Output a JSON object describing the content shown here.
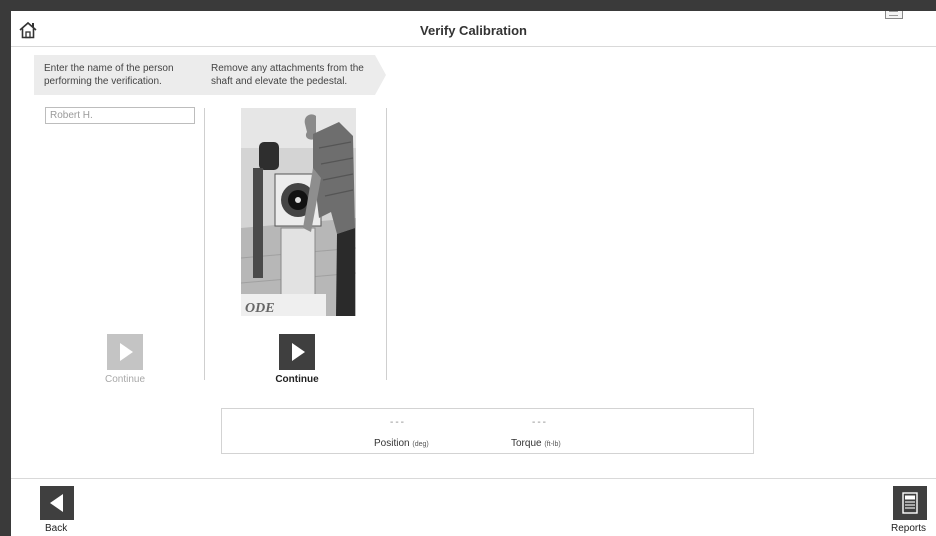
{
  "header": {
    "title": "Verify Calibration",
    "home_icon": "home-icon"
  },
  "steps": [
    {
      "instruction": "Enter the name of the person performing the verification.",
      "input_value": "Robert H.",
      "continue_label": "Continue",
      "continue_enabled": false
    },
    {
      "instruction": "Remove any attachments from the shaft and elevate the pedestal.",
      "continue_label": "Continue",
      "continue_enabled": true
    }
  ],
  "readout": {
    "position_value": "---",
    "position_label": "Position",
    "position_unit": "(deg)",
    "torque_value": "---",
    "torque_label": "Torque",
    "torque_unit": "(ft-lb)"
  },
  "footer": {
    "back_label": "Back",
    "reports_label": "Reports"
  },
  "colors": {
    "button_active": "#3f3f3f",
    "button_disabled": "#c4c4c4",
    "header_arrow_bg": "#ececec"
  }
}
